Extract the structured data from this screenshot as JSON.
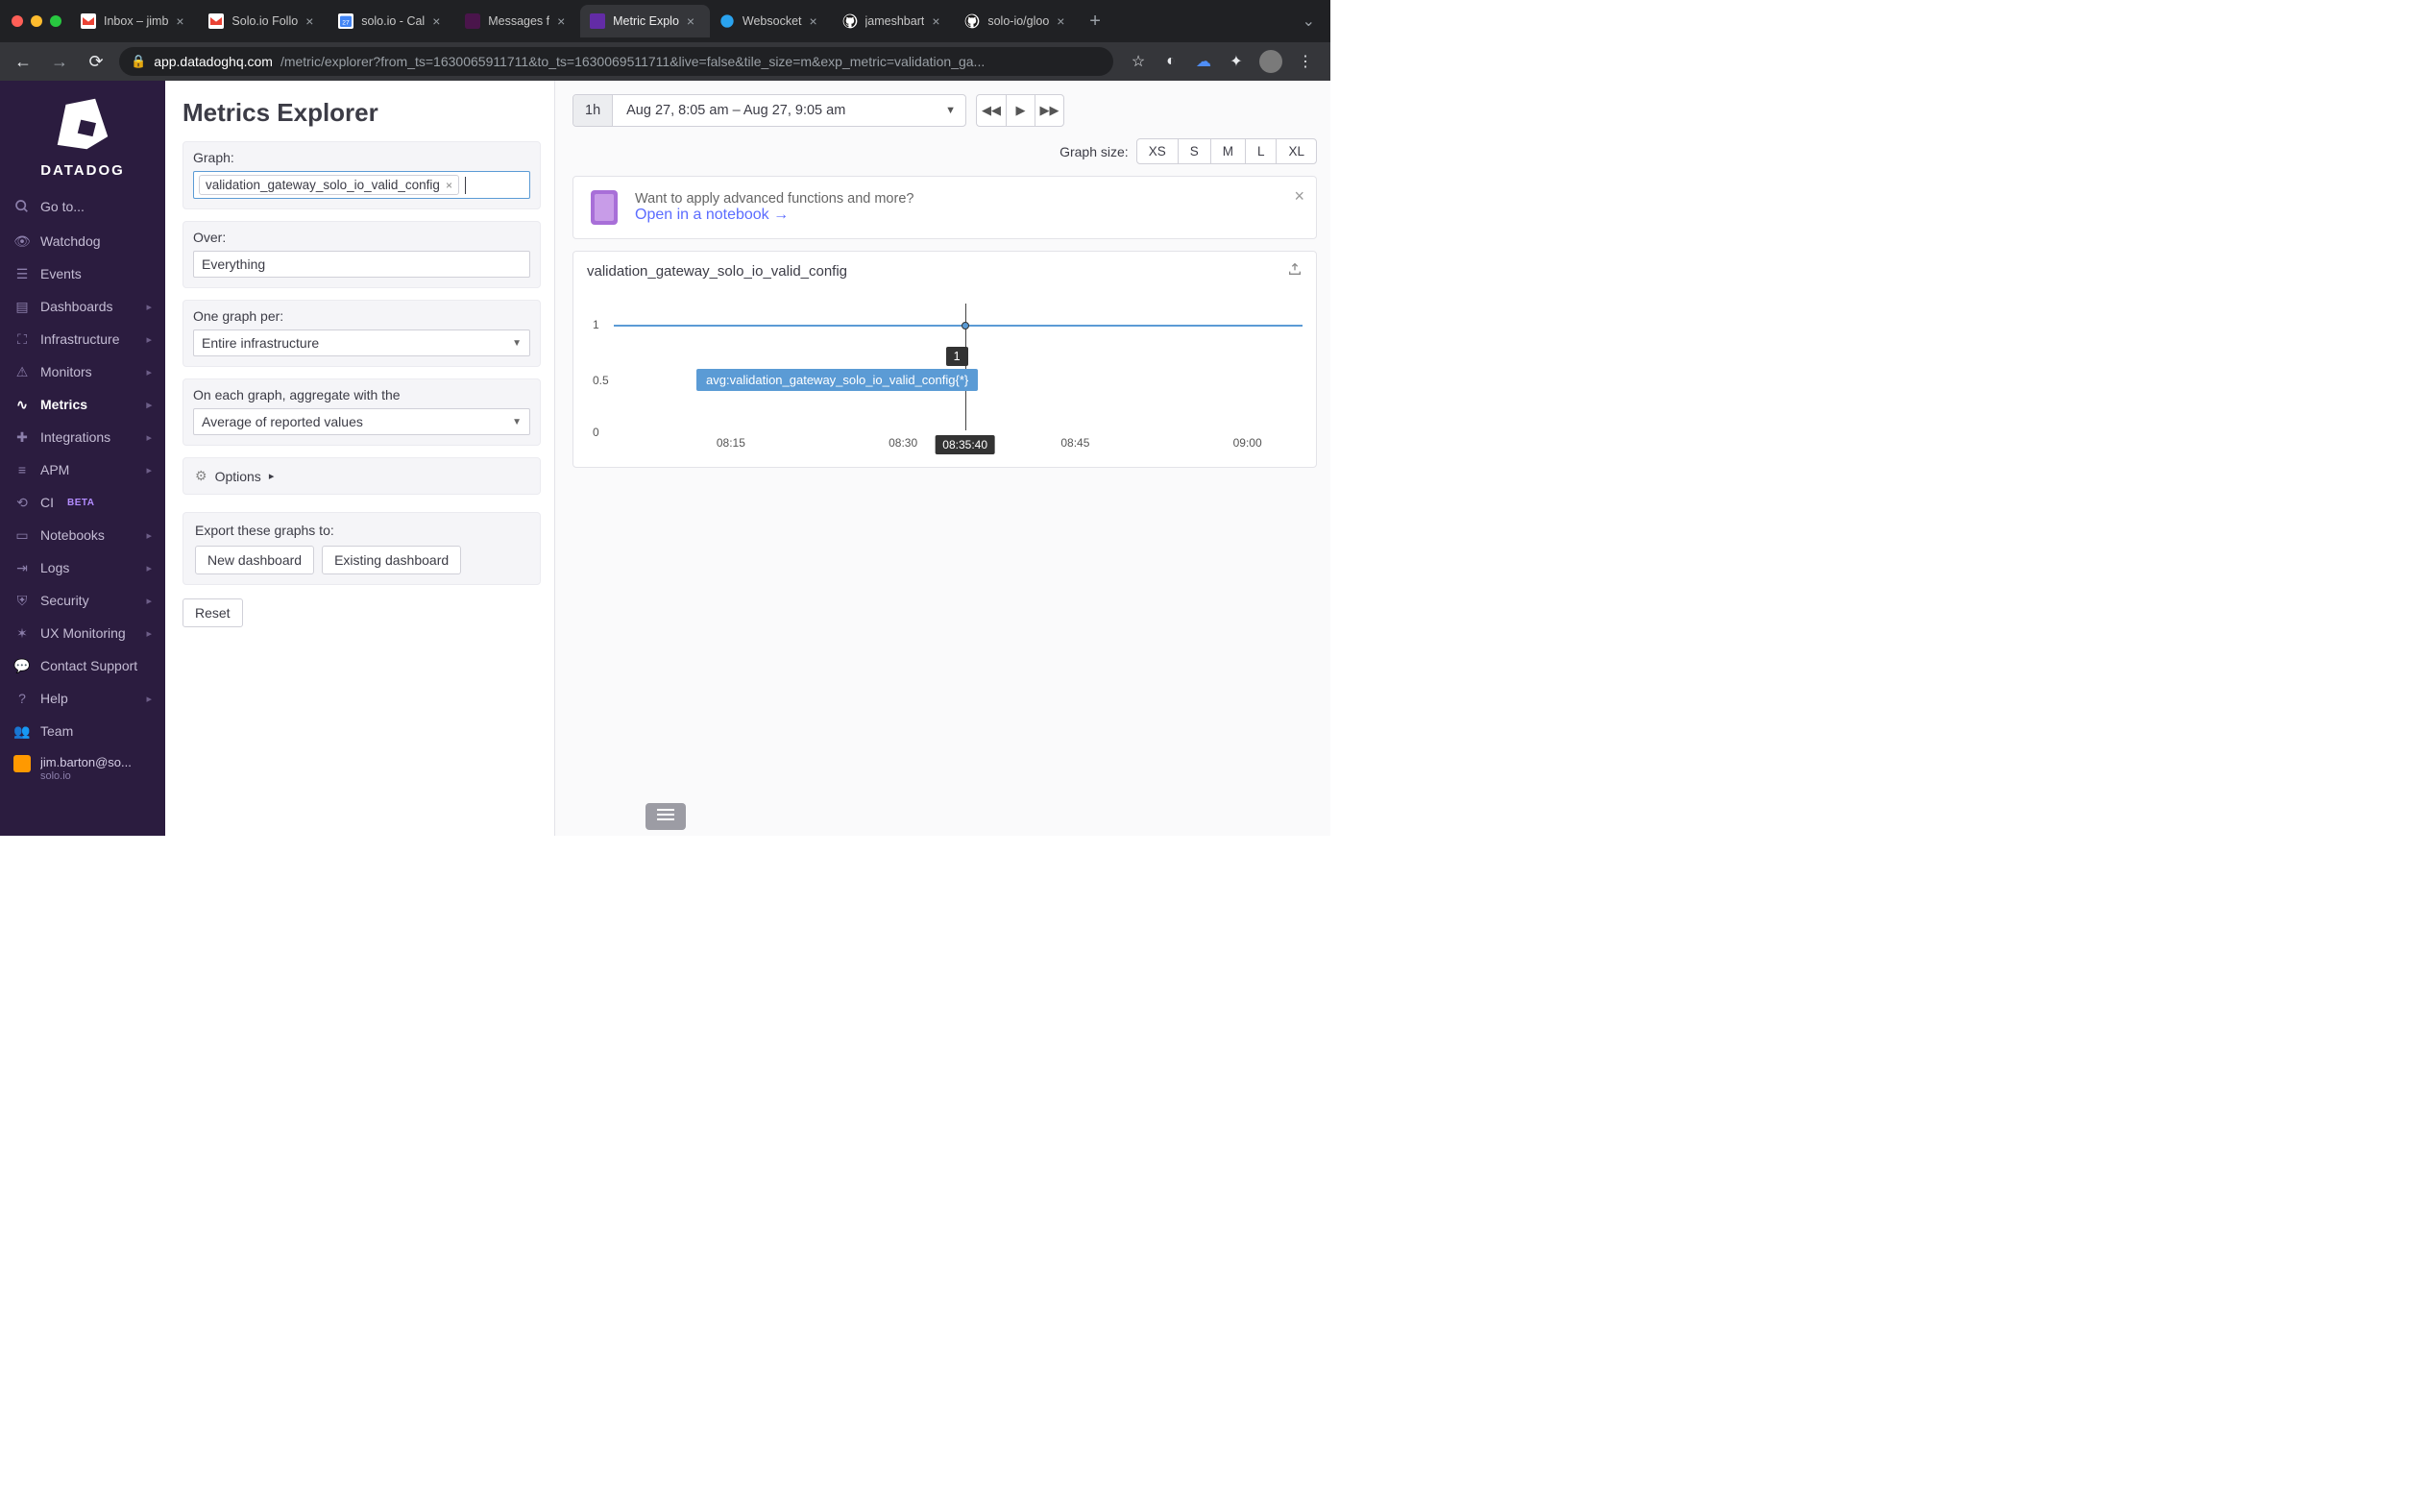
{
  "browser": {
    "tabs": [
      {
        "label": "Inbox – jimb",
        "icon": "gmail"
      },
      {
        "label": "Solo.io Follo",
        "icon": "gmail"
      },
      {
        "label": "solo.io - Cal",
        "icon": "calendar"
      },
      {
        "label": "Messages f",
        "icon": "slack"
      },
      {
        "label": "Metric Explo",
        "icon": "datadog",
        "active": true
      },
      {
        "label": "Websocket",
        "icon": "solo"
      },
      {
        "label": "jameshbart",
        "icon": "github"
      },
      {
        "label": "solo-io/gloo",
        "icon": "github"
      }
    ],
    "url_host": "app.datadoghq.com",
    "url_path": "/metric/explorer?from_ts=1630065911711&to_ts=1630069511711&live=false&tile_size=m&exp_metric=validation_ga..."
  },
  "sidebar": {
    "brand": "DATADOG",
    "goto": "Go to...",
    "items": [
      {
        "label": "Watchdog",
        "icon": "binoculars"
      },
      {
        "label": "Events",
        "icon": "list"
      },
      {
        "label": "Dashboards",
        "icon": "dashboard",
        "chev": true
      },
      {
        "label": "Infrastructure",
        "icon": "infra",
        "chev": true
      },
      {
        "label": "Monitors",
        "icon": "alert",
        "chev": true
      },
      {
        "label": "Metrics",
        "icon": "metrics",
        "chev": true,
        "active": true
      },
      {
        "label": "Integrations",
        "icon": "puzzle",
        "chev": true
      },
      {
        "label": "APM",
        "icon": "apm",
        "chev": true
      },
      {
        "label": "CI",
        "icon": "ci",
        "beta": "BETA"
      },
      {
        "label": "Notebooks",
        "icon": "book",
        "chev": true
      },
      {
        "label": "Logs",
        "icon": "logs",
        "chev": true
      },
      {
        "label": "Security",
        "icon": "shield",
        "chev": true
      },
      {
        "label": "UX Monitoring",
        "icon": "ux",
        "chev": true
      },
      {
        "label": "Contact Support",
        "icon": "chat"
      },
      {
        "label": "Help",
        "icon": "help",
        "chev": true
      },
      {
        "label": "Team",
        "icon": "team"
      }
    ],
    "user_email": "jim.barton@so...",
    "user_org": "solo.io"
  },
  "config": {
    "page_title": "Metrics Explorer",
    "graph_label": "Graph:",
    "graph_metric": "validation_gateway_solo_io_valid_config",
    "over_label": "Over:",
    "over_value": "Everything",
    "per_label": "One graph per:",
    "per_value": "Entire infrastructure",
    "agg_label": "On each graph, aggregate with the",
    "agg_value": "Average of reported values",
    "options": "Options",
    "export_label": "Export these graphs to:",
    "export_new": "New dashboard",
    "export_existing": "Existing dashboard",
    "reset": "Reset"
  },
  "main": {
    "time_preset": "1h",
    "time_range": "Aug 27, 8:05 am – Aug 27, 9:05 am",
    "size_label": "Graph size:",
    "sizes": [
      "XS",
      "S",
      "M",
      "L",
      "XL"
    ],
    "banner_text": "Want to apply advanced functions and more?",
    "banner_link": "Open in a notebook →",
    "chart_title": "validation_gateway_solo_io_valid_config",
    "hover_value": "1",
    "hover_time": "08:35:40",
    "series_label": "avg:validation_gateway_solo_io_valid_config{*}"
  },
  "chart_data": {
    "type": "line",
    "title": "validation_gateway_solo_io_valid_config",
    "x_range": [
      "08:05",
      "09:05"
    ],
    "x_ticks": [
      "08:15",
      "08:30",
      "08:45",
      "09:00"
    ],
    "y_ticks": [
      0,
      0.5,
      1
    ],
    "ylim": [
      0,
      1.1
    ],
    "series": [
      {
        "name": "avg:validation_gateway_solo_io_valid_config{*}",
        "value_constant": 1
      }
    ],
    "hover": {
      "time": "08:35:40",
      "value": 1,
      "x_frac": 0.51
    }
  }
}
